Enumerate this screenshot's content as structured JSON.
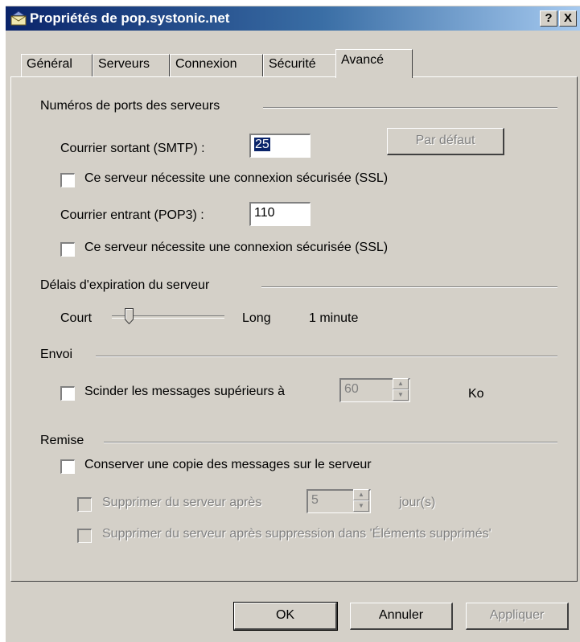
{
  "window": {
    "title": "Propriétés de pop.systonic.net",
    "help_label": "?",
    "close_label": "X"
  },
  "tabs": [
    "Général",
    "Serveurs",
    "Connexion",
    "Sécurité",
    "Avancé"
  ],
  "active_tab": "Avancé",
  "ports": {
    "title": "Numéros de ports des serveurs",
    "smtp_label": "Courrier sortant (SMTP) :",
    "smtp_value": "25",
    "default_button": "Par défaut",
    "ssl_smtp_label": "Ce serveur nécessite une connexion sécurisée (SSL)",
    "ssl_smtp_checked": false,
    "pop3_label": "Courrier entrant (POP3) :",
    "pop3_value": "110",
    "ssl_pop3_label": "Ce serveur nécessite une connexion sécurisée (SSL)",
    "ssl_pop3_checked": false
  },
  "timeout": {
    "title": "Délais d'expiration du serveur",
    "short_label": "Court",
    "long_label": "Long",
    "value_label": "1 minute",
    "level": 0.15
  },
  "sending": {
    "title": "Envoi",
    "split_label": "Scinder les messages supérieurs à",
    "split_value": "60",
    "unit": "Ko",
    "split_checked": false
  },
  "delivery": {
    "title": "Remise",
    "keep_copy_label": "Conserver une copie des messages sur le serveur",
    "keep_copy_checked": false,
    "delete_after_label": "Supprimer du serveur après",
    "delete_after_value": "5",
    "delete_after_unit": "jour(s)",
    "delete_on_remove_label": "Supprimer du serveur après suppression dans 'Éléments supprimés'"
  },
  "buttons": {
    "ok": "OK",
    "cancel": "Annuler",
    "apply": "Appliquer"
  },
  "colors": {
    "face": "#d4d0c8",
    "title_start": "#0a246a",
    "title_end": "#a6caf0",
    "selection": "#0a246a"
  }
}
